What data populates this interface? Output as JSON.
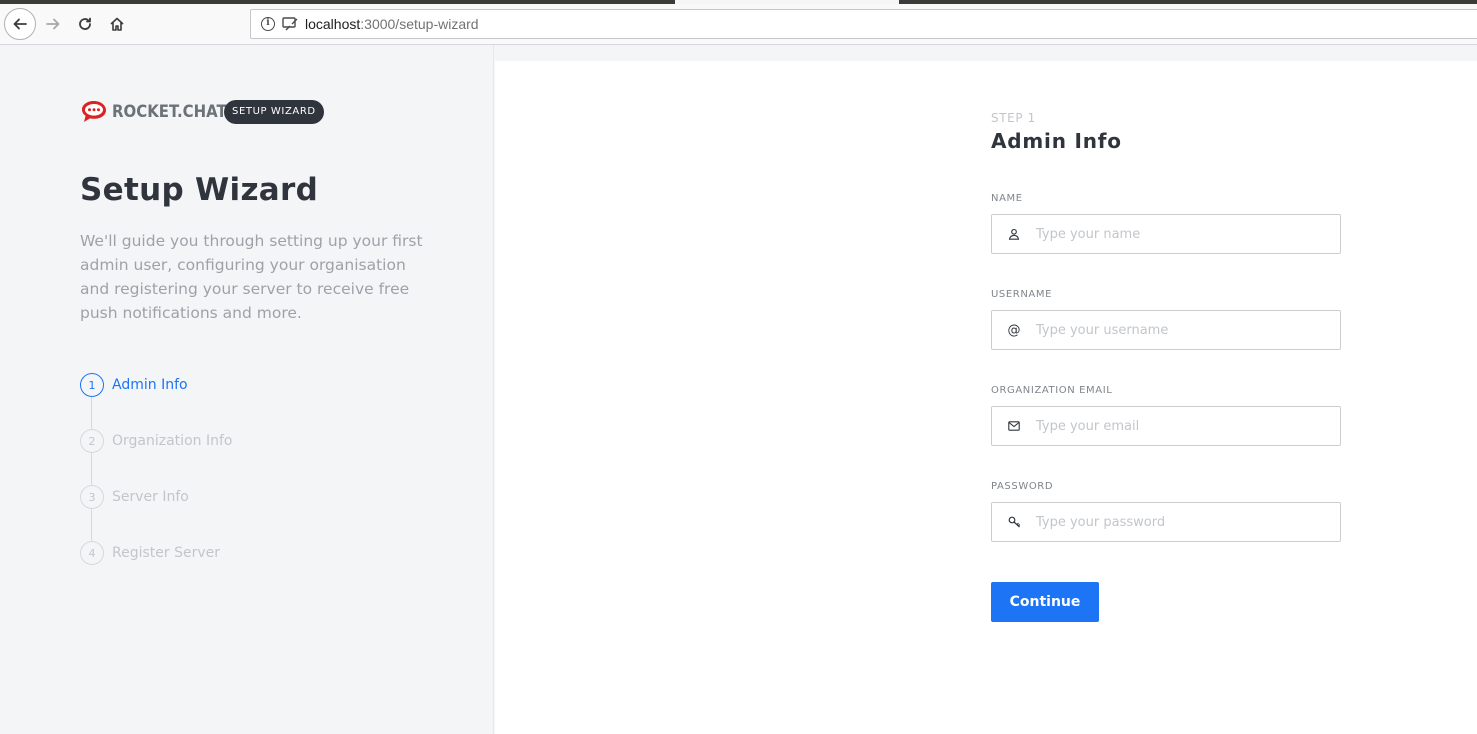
{
  "browser": {
    "url_host": "localhost",
    "url_path": ":3000/setup-wizard"
  },
  "sidebar": {
    "brand_name": "ROCKET.CHAT",
    "badge": "SETUP WIZARD",
    "title": "Setup Wizard",
    "description": "We'll guide you through setting up your first admin user, configuring your organisation and registering your server to receive free push notifications and more.",
    "steps": [
      {
        "number": "1",
        "label": "Admin Info",
        "active": true
      },
      {
        "number": "2",
        "label": "Organization Info",
        "active": false
      },
      {
        "number": "3",
        "label": "Server Info",
        "active": false
      },
      {
        "number": "4",
        "label": "Register Server",
        "active": false
      }
    ]
  },
  "form": {
    "step": "STEP 1",
    "title": "Admin Info",
    "fields": [
      {
        "label": "NAME",
        "placeholder": "Type your name",
        "icon": "user-icon"
      },
      {
        "label": "USERNAME",
        "placeholder": "Type your username",
        "icon": "at-icon"
      },
      {
        "label": "ORGANIZATION EMAIL",
        "placeholder": "Type your email",
        "icon": "mail-icon"
      },
      {
        "label": "PASSWORD",
        "placeholder": "Type your password",
        "icon": "key-icon"
      }
    ],
    "submit_label": "Continue"
  },
  "colors": {
    "accent": "#1d74f5",
    "brand_red": "#db2323",
    "sidebar_bg": "#f4f5f7",
    "badge_bg": "#2f343d"
  }
}
